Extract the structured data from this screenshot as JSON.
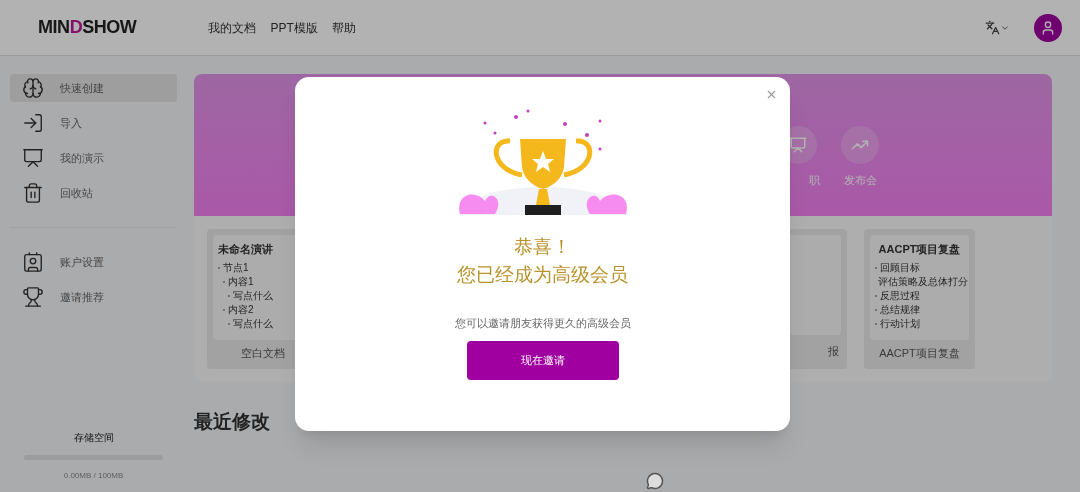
{
  "header": {
    "logo": {
      "before": "MIN",
      "accent_letter": "D",
      "after": "SHOW"
    },
    "nav": [
      "我的文档",
      "PPT模版",
      "帮助"
    ]
  },
  "sidebar": {
    "items": [
      {
        "label": "快速创建",
        "kind": "create",
        "selected": true
      },
      {
        "label": "导入",
        "kind": "import",
        "selected": false
      },
      {
        "label": "我的演示",
        "kind": "slides",
        "selected": false
      },
      {
        "label": "回收站",
        "kind": "trash",
        "selected": false
      }
    ],
    "items_2": [
      {
        "label": "账户设置",
        "kind": "account",
        "selected": false
      },
      {
        "label": "邀请推荐",
        "kind": "trophy",
        "selected": false
      }
    ],
    "storage": {
      "title": "存储空间",
      "level": 0,
      "reading": "0.00MB / 100MB"
    }
  },
  "banner": {
    "items": [
      {
        "label": "职",
        "kind": "slides"
      },
      {
        "label": "发布会",
        "kind": "chart"
      }
    ]
  },
  "templates": [
    {
      "title": "未命名演讲",
      "kind": "outline",
      "lines": [
        {
          "text": "节点1",
          "children": [
            {
              "text": "内容1",
              "children": [
                {
                  "text": "写点什么"
                }
              ]
            },
            {
              "text": "内容2",
              "children": [
                {
                  "text": "写点什么"
                }
              ]
            }
          ]
        }
      ],
      "label": "空白文档"
    },
    {
      "kind": "partial",
      "label": "报"
    },
    {
      "title": "AACPT项目复盘",
      "kind": "bullets",
      "lines": [
        {
          "text": "回顾目标"
        },
        {
          "text": "评估策略及总体打分"
        },
        {
          "text": "反思过程"
        },
        {
          "text": "总结规律"
        },
        {
          "text": "行动计划"
        }
      ],
      "label": "AACPT项目复盘"
    }
  ],
  "recent": {
    "title": "最近修改"
  },
  "dialog": {
    "title_line_1": "恭喜！",
    "title_line_2": "您已经成为高级会员",
    "message": "您可以邀请朋友获得更久的高级会员",
    "button": "现在邀请"
  }
}
